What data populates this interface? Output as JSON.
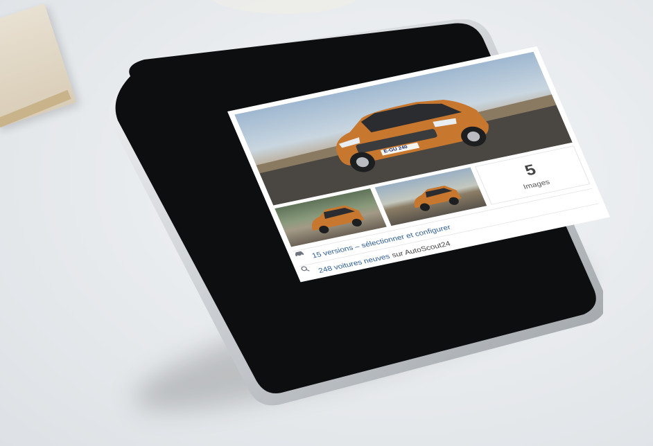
{
  "gallery": {
    "image_count": "5",
    "image_label": "Images"
  },
  "links": {
    "versions": {
      "icon": "car-icon",
      "text": "15 versions – sélectionner et configurer"
    },
    "offers": {
      "icon": "search-icon",
      "link_text": "248 voitures neuves",
      "suffix_text": "sur AutoScout24"
    }
  },
  "hero": {
    "plate_text": "E-GU 240"
  },
  "colors": {
    "link": "#2d5c8f",
    "car_body": "#c7772e",
    "screen_bg": "#ffffff"
  }
}
